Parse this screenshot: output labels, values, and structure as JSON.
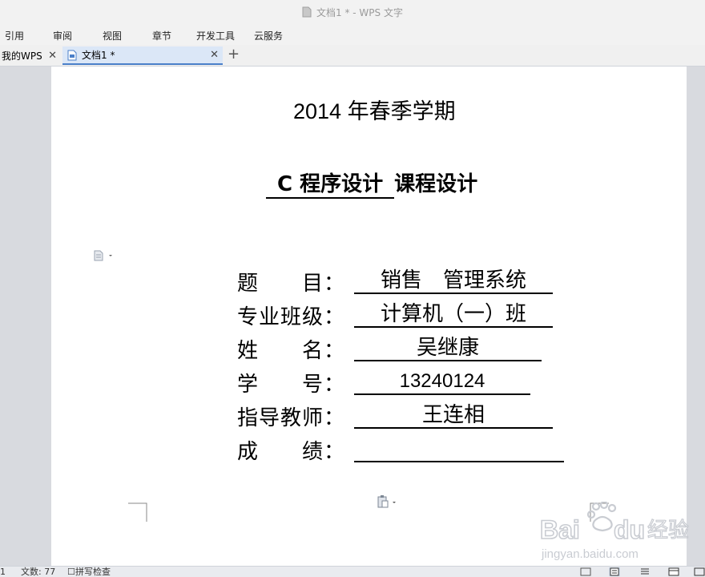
{
  "window": {
    "title": "文档1 * - WPS 文字"
  },
  "menu": {
    "items": [
      "引用",
      "审阅",
      "视图",
      "章节",
      "开发工具",
      "云服务"
    ]
  },
  "tabs": {
    "home_label": "我的WPS",
    "doc_label": "文档1 *"
  },
  "document": {
    "semester": "2014 年春季学期",
    "course_name": "C 程序设计",
    "course_suffix": "课程设计",
    "fields": [
      {
        "label": "题　　目：",
        "value": "销售　管理系统"
      },
      {
        "label": "专业班级：",
        "value": "计算机（一）班"
      },
      {
        "label": "姓　　名：",
        "value": "吴继康"
      },
      {
        "label": "学　　号：",
        "value": "13240124"
      },
      {
        "label": "指导教师：",
        "value": "王连相"
      },
      {
        "label": "成　　绩：",
        "value": ""
      }
    ]
  },
  "status": {
    "page_text": "1",
    "word_count": "文数: 77",
    "spell_check": "拼写检查"
  },
  "watermark": {
    "brand": "Baidu经验",
    "url": "jingyan.baidu.com"
  },
  "colors": {
    "tab_active": "#dbe7f7",
    "tab_accent": "#4a7fc9",
    "background": "#d8dadf"
  }
}
